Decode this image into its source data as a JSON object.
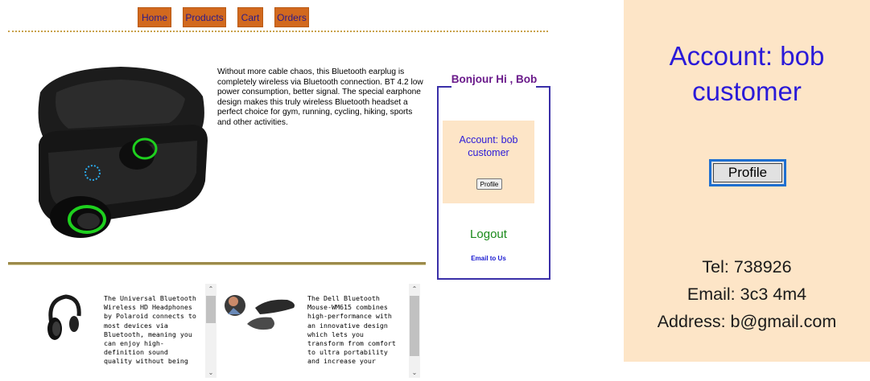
{
  "nav": {
    "items": [
      {
        "label": "Home"
      },
      {
        "label": "Products"
      },
      {
        "label": "Cart"
      },
      {
        "label": "Orders"
      }
    ]
  },
  "product": {
    "image_icon": "bluetooth-earbuds-image",
    "description": "Without more cable chaos, this Bluetooth earplug is completely wireless via Bluetooth connection. BT 4.2 low power consumption, better signal. The special earphone design makes this truly wireless Bluetooth headset a perfect choice for gym, running, cycling, hiking, sports and other activities."
  },
  "user_panel": {
    "greeting": "Bonjour Hi , Bob",
    "account_line1": "Account: bob",
    "account_line2": "customer",
    "profile_label": "Profile",
    "logout_label": "Logout",
    "email_label": "Email to Us"
  },
  "list_items": [
    {
      "image_icon": "headphones-image",
      "text": "The Universal Bluetooth\nWireless HD Headphones\nby Polaroid connects to\nmost devices via\nBluetooth, meaning you\ncan enjoy high-\ndefinition sound\nquality without being"
    },
    {
      "image_icon": "mouse-image",
      "text": "The Dell Bluetooth\nMouse-WM615 combines\nhigh-performance with\nan innovative design\nwhich lets you\ntransform from comfort\nto ultra portability\nand increase your"
    }
  ],
  "zoom_panel": {
    "account_line1": "Account: bob",
    "account_line2": "customer",
    "profile_label": "Profile",
    "tel": "Tel: 738926",
    "email": "Email: 3c3 4m4",
    "address": "Address: b@gmail.com"
  },
  "colors": {
    "nav_bg": "#d2691e",
    "panel_bg": "#fde5c7",
    "account_blue": "#2a1ad8",
    "greeting_purple": "#6a1a8a",
    "logout_green": "#1a8a1a"
  }
}
